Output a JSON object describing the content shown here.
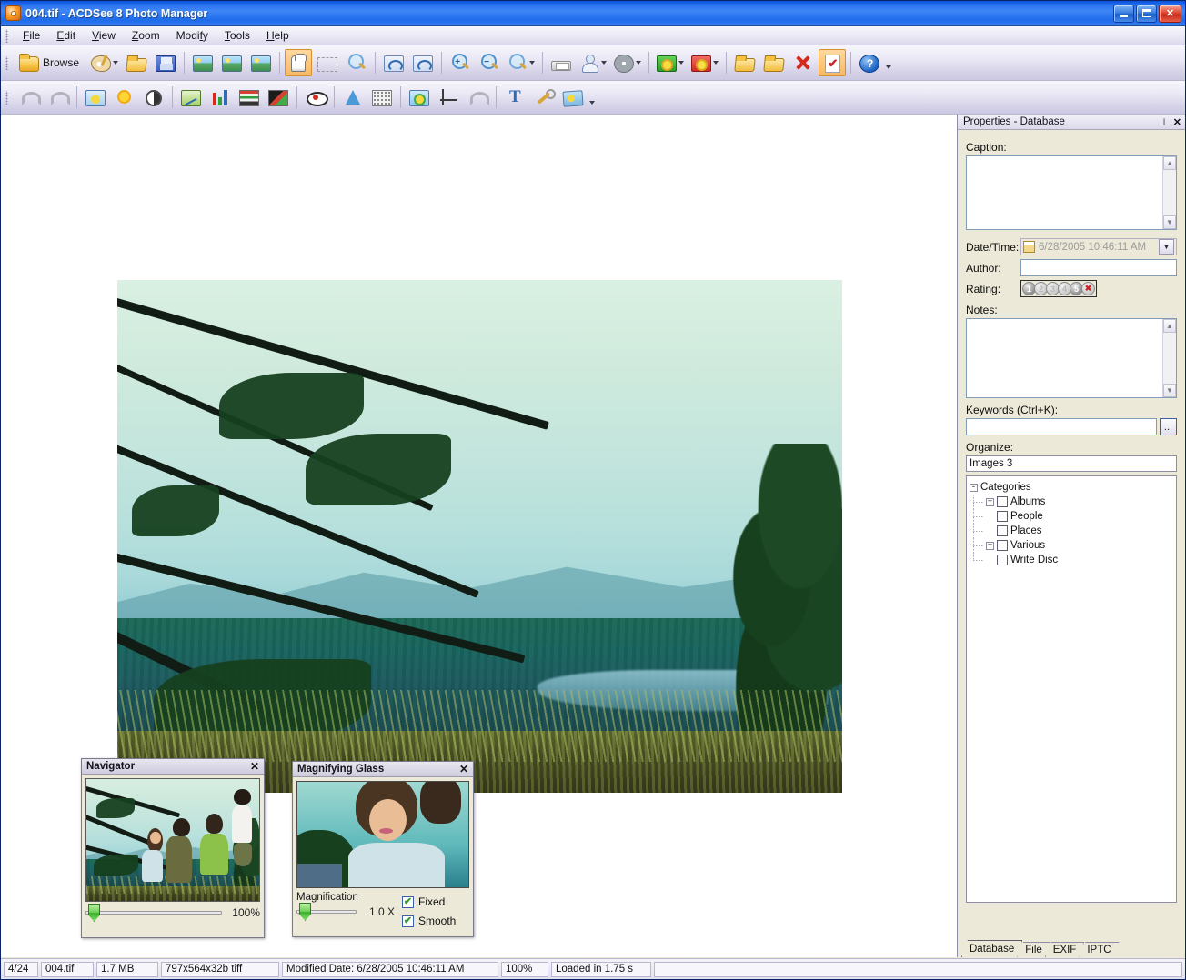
{
  "window": {
    "title": "004.tif - ACDSee 8 Photo Manager",
    "app_icon": "acdsee-icon",
    "controls": {
      "minimize": "minimize",
      "maximize": "maximize",
      "close": "close"
    }
  },
  "menubar": {
    "items": [
      {
        "label": "File",
        "accel": "F"
      },
      {
        "label": "Edit",
        "accel": "E"
      },
      {
        "label": "View",
        "accel": "V"
      },
      {
        "label": "Zoom",
        "accel": "Z"
      },
      {
        "label": "Modify",
        "accel": "f"
      },
      {
        "label": "Tools",
        "accel": "T"
      },
      {
        "label": "Help",
        "accel": "H"
      }
    ]
  },
  "toolbar_main": {
    "items": [
      {
        "name": "browse-button",
        "icon": "browse-folder-icon",
        "label": "Browse",
        "active": false,
        "caret": false
      },
      {
        "name": "edit-mode-button",
        "icon": "palette-icon",
        "label": "",
        "active": false,
        "caret": true
      },
      {
        "name": "open-button",
        "icon": "open-folder-icon",
        "label": "",
        "active": false,
        "caret": false
      },
      {
        "name": "save-button",
        "icon": "floppy-disk-icon",
        "label": "",
        "active": false,
        "caret": false
      },
      {
        "name": "previous-image-button",
        "icon": "previous-image-icon",
        "label": "",
        "active": false,
        "caret": false
      },
      {
        "name": "next-image-button",
        "icon": "next-image-icon",
        "label": "",
        "active": false,
        "caret": false
      },
      {
        "name": "slideshow-button",
        "icon": "slideshow-icon",
        "label": "",
        "active": false,
        "caret": false
      },
      {
        "name": "pan-tool-button",
        "icon": "hand-icon",
        "label": "",
        "active": true,
        "caret": false
      },
      {
        "name": "select-tool-button",
        "icon": "marquee-select-icon",
        "label": "",
        "active": false,
        "caret": false
      },
      {
        "name": "magnifier-tool-button",
        "icon": "magnifying-glass-icon",
        "label": "",
        "active": false,
        "caret": false
      },
      {
        "name": "rotate-left-button",
        "icon": "rotate-left-icon",
        "label": "",
        "active": false,
        "caret": false
      },
      {
        "name": "rotate-right-button",
        "icon": "rotate-right-icon",
        "label": "",
        "active": false,
        "caret": false
      },
      {
        "name": "zoom-in-button",
        "icon": "zoom-in-icon",
        "label": "",
        "active": false,
        "caret": false
      },
      {
        "name": "zoom-out-button",
        "icon": "zoom-out-icon",
        "label": "",
        "active": false,
        "caret": false
      },
      {
        "name": "zoom-select-button",
        "icon": "zoom-icon",
        "label": "",
        "active": false,
        "caret": true
      },
      {
        "name": "print-button",
        "icon": "printer-icon",
        "label": "",
        "active": false,
        "caret": false
      },
      {
        "name": "share-button",
        "icon": "person-share-icon",
        "label": "",
        "active": false,
        "caret": true
      },
      {
        "name": "burn-disc-button",
        "icon": "cd-disc-icon",
        "label": "",
        "active": false,
        "caret": true
      },
      {
        "name": "acquire-button",
        "icon": "green-flower-icon",
        "label": "",
        "active": false,
        "caret": true
      },
      {
        "name": "effects-button",
        "icon": "red-flower-icon",
        "label": "",
        "active": false,
        "caret": true
      },
      {
        "name": "move-to-button",
        "icon": "folder-out-icon",
        "label": "",
        "active": false,
        "caret": false
      },
      {
        "name": "copy-to-button",
        "icon": "folder-in-icon",
        "label": "",
        "active": false,
        "caret": false
      },
      {
        "name": "delete-button",
        "icon": "red-x-icon",
        "label": "",
        "active": false,
        "caret": false
      },
      {
        "name": "properties-button",
        "icon": "checklist-doc-icon",
        "label": "",
        "active": true,
        "caret": false
      },
      {
        "name": "help-button",
        "icon": "help-icon",
        "label": "",
        "active": false,
        "caret": false
      }
    ],
    "overflow_caret": "chevron-down-icon"
  },
  "toolbar_edit": {
    "items": [
      {
        "name": "undo-button",
        "icon": "undo-arrow-icon"
      },
      {
        "name": "redo-button",
        "icon": "redo-arrow-icon"
      },
      {
        "name": "exposure-button",
        "icon": "exposure-icon"
      },
      {
        "name": "brightness-button",
        "icon": "sun-icon"
      },
      {
        "name": "contrast-button",
        "icon": "contrast-icon"
      },
      {
        "name": "levels-button",
        "icon": "levels-icon"
      },
      {
        "name": "histogram-button",
        "icon": "histogram-icon"
      },
      {
        "name": "color-balance-button",
        "icon": "color-bars-icon"
      },
      {
        "name": "color-gradient-button",
        "icon": "gradient-icon"
      },
      {
        "name": "red-eye-button",
        "icon": "red-eye-icon"
      },
      {
        "name": "sharpen-button",
        "icon": "sharpen-triangle-icon"
      },
      {
        "name": "noise-button",
        "icon": "noise-icon"
      },
      {
        "name": "special-effects-button",
        "icon": "flower-photo-icon"
      },
      {
        "name": "crop-button",
        "icon": "crop-icon"
      },
      {
        "name": "repair-tool-button",
        "icon": "repair-hand-icon"
      },
      {
        "name": "add-text-button",
        "icon": "text-t-icon"
      },
      {
        "name": "settings-button",
        "icon": "wrench-icon"
      },
      {
        "name": "collage-button",
        "icon": "collage-icon"
      }
    ],
    "overflow_caret": "chevron-down-icon"
  },
  "viewer": {
    "image_name": "004.tif",
    "image_alt": "Family of five sitting on a grassy cliff overlooking a forested valley and lake"
  },
  "navigator": {
    "title": "Navigator",
    "close_icon": "close-icon",
    "zoom_value": "100%"
  },
  "magnifier": {
    "title": "Magnifying Glass",
    "close_icon": "close-icon",
    "magnification_label": "Magnification",
    "magnification_value": "1.0 X",
    "fixed_label": "Fixed",
    "fixed_checked": true,
    "smooth_label": "Smooth",
    "smooth_checked": true
  },
  "properties": {
    "title": "Properties - Database",
    "pin_icon": "pin-icon",
    "close_icon": "close-icon",
    "caption_label": "Caption:",
    "caption_value": "",
    "datetime_label": "Date/Time:",
    "datetime_value": "6/28/2005 10:46:11 AM",
    "datetime_calendar_icon": "calendar-icon",
    "datetime_dropdown_icon": "chevron-down-icon",
    "author_label": "Author:",
    "author_value": "",
    "rating_label": "Rating:",
    "rating_values": [
      "1",
      "2",
      "3",
      "4",
      "5"
    ],
    "rating_selected": 0,
    "rating_clear_icon": "clear-rating-icon",
    "notes_label": "Notes:",
    "notes_value": "",
    "keywords_label": "Keywords (Ctrl+K):",
    "keywords_value": "",
    "keywords_browse_label": "...",
    "organize_label": "Organize:",
    "organize_value": "Images 3",
    "tree": {
      "root": {
        "label": "Categories",
        "expander": "-"
      },
      "children": [
        {
          "label": "Albums",
          "expander": "+",
          "checked": false
        },
        {
          "label": "People",
          "expander": "",
          "checked": false
        },
        {
          "label": "Places",
          "expander": "",
          "checked": false
        },
        {
          "label": "Various",
          "expander": "+",
          "checked": false
        },
        {
          "label": "Write Disc",
          "expander": "",
          "checked": false
        }
      ]
    },
    "tabs": [
      {
        "label": "Database",
        "active": true
      },
      {
        "label": "File",
        "active": false
      },
      {
        "label": "EXIF",
        "active": false
      },
      {
        "label": "IPTC",
        "active": false
      }
    ]
  },
  "statusbar": {
    "cells": [
      {
        "name": "image-index",
        "value": "4/24"
      },
      {
        "name": "file-name",
        "value": "004.tif"
      },
      {
        "name": "file-size",
        "value": "1.7 MB"
      },
      {
        "name": "image-dims",
        "value": "797x564x32b tiff"
      },
      {
        "name": "modified-date",
        "value": "Modified Date: 6/28/2005 10:46:11 AM"
      },
      {
        "name": "zoom-level",
        "value": "100%"
      },
      {
        "name": "load-time",
        "value": "Loaded in 1.75 s"
      }
    ]
  },
  "colors": {
    "titlebar_blue": "#2a74f0",
    "toolbar_lavender": "#e9e7f4",
    "panel_beige": "#ece9d8",
    "active_orange": "#f7b865",
    "accent_red": "#d42b1f"
  }
}
